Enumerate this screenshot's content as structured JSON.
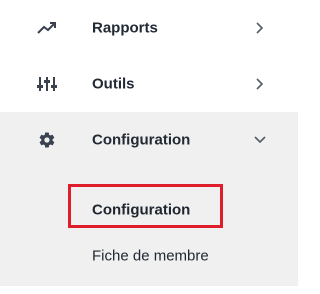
{
  "menu": {
    "items": [
      {
        "label": "Rapports",
        "icon": "trending-up-icon",
        "chevron": "chevron-right-icon"
      },
      {
        "label": "Outils",
        "icon": "sliders-icon",
        "chevron": "chevron-right-icon"
      },
      {
        "label": "Configuration",
        "icon": "gear-icon",
        "chevron": "chevron-down-icon"
      }
    ],
    "submenu": [
      {
        "label": "Configuration"
      },
      {
        "label": "Fiche de membre"
      }
    ]
  },
  "colors": {
    "text": "#222a35",
    "submenu_bg": "#f0f0f0",
    "highlight_border": "#e01e2b"
  }
}
